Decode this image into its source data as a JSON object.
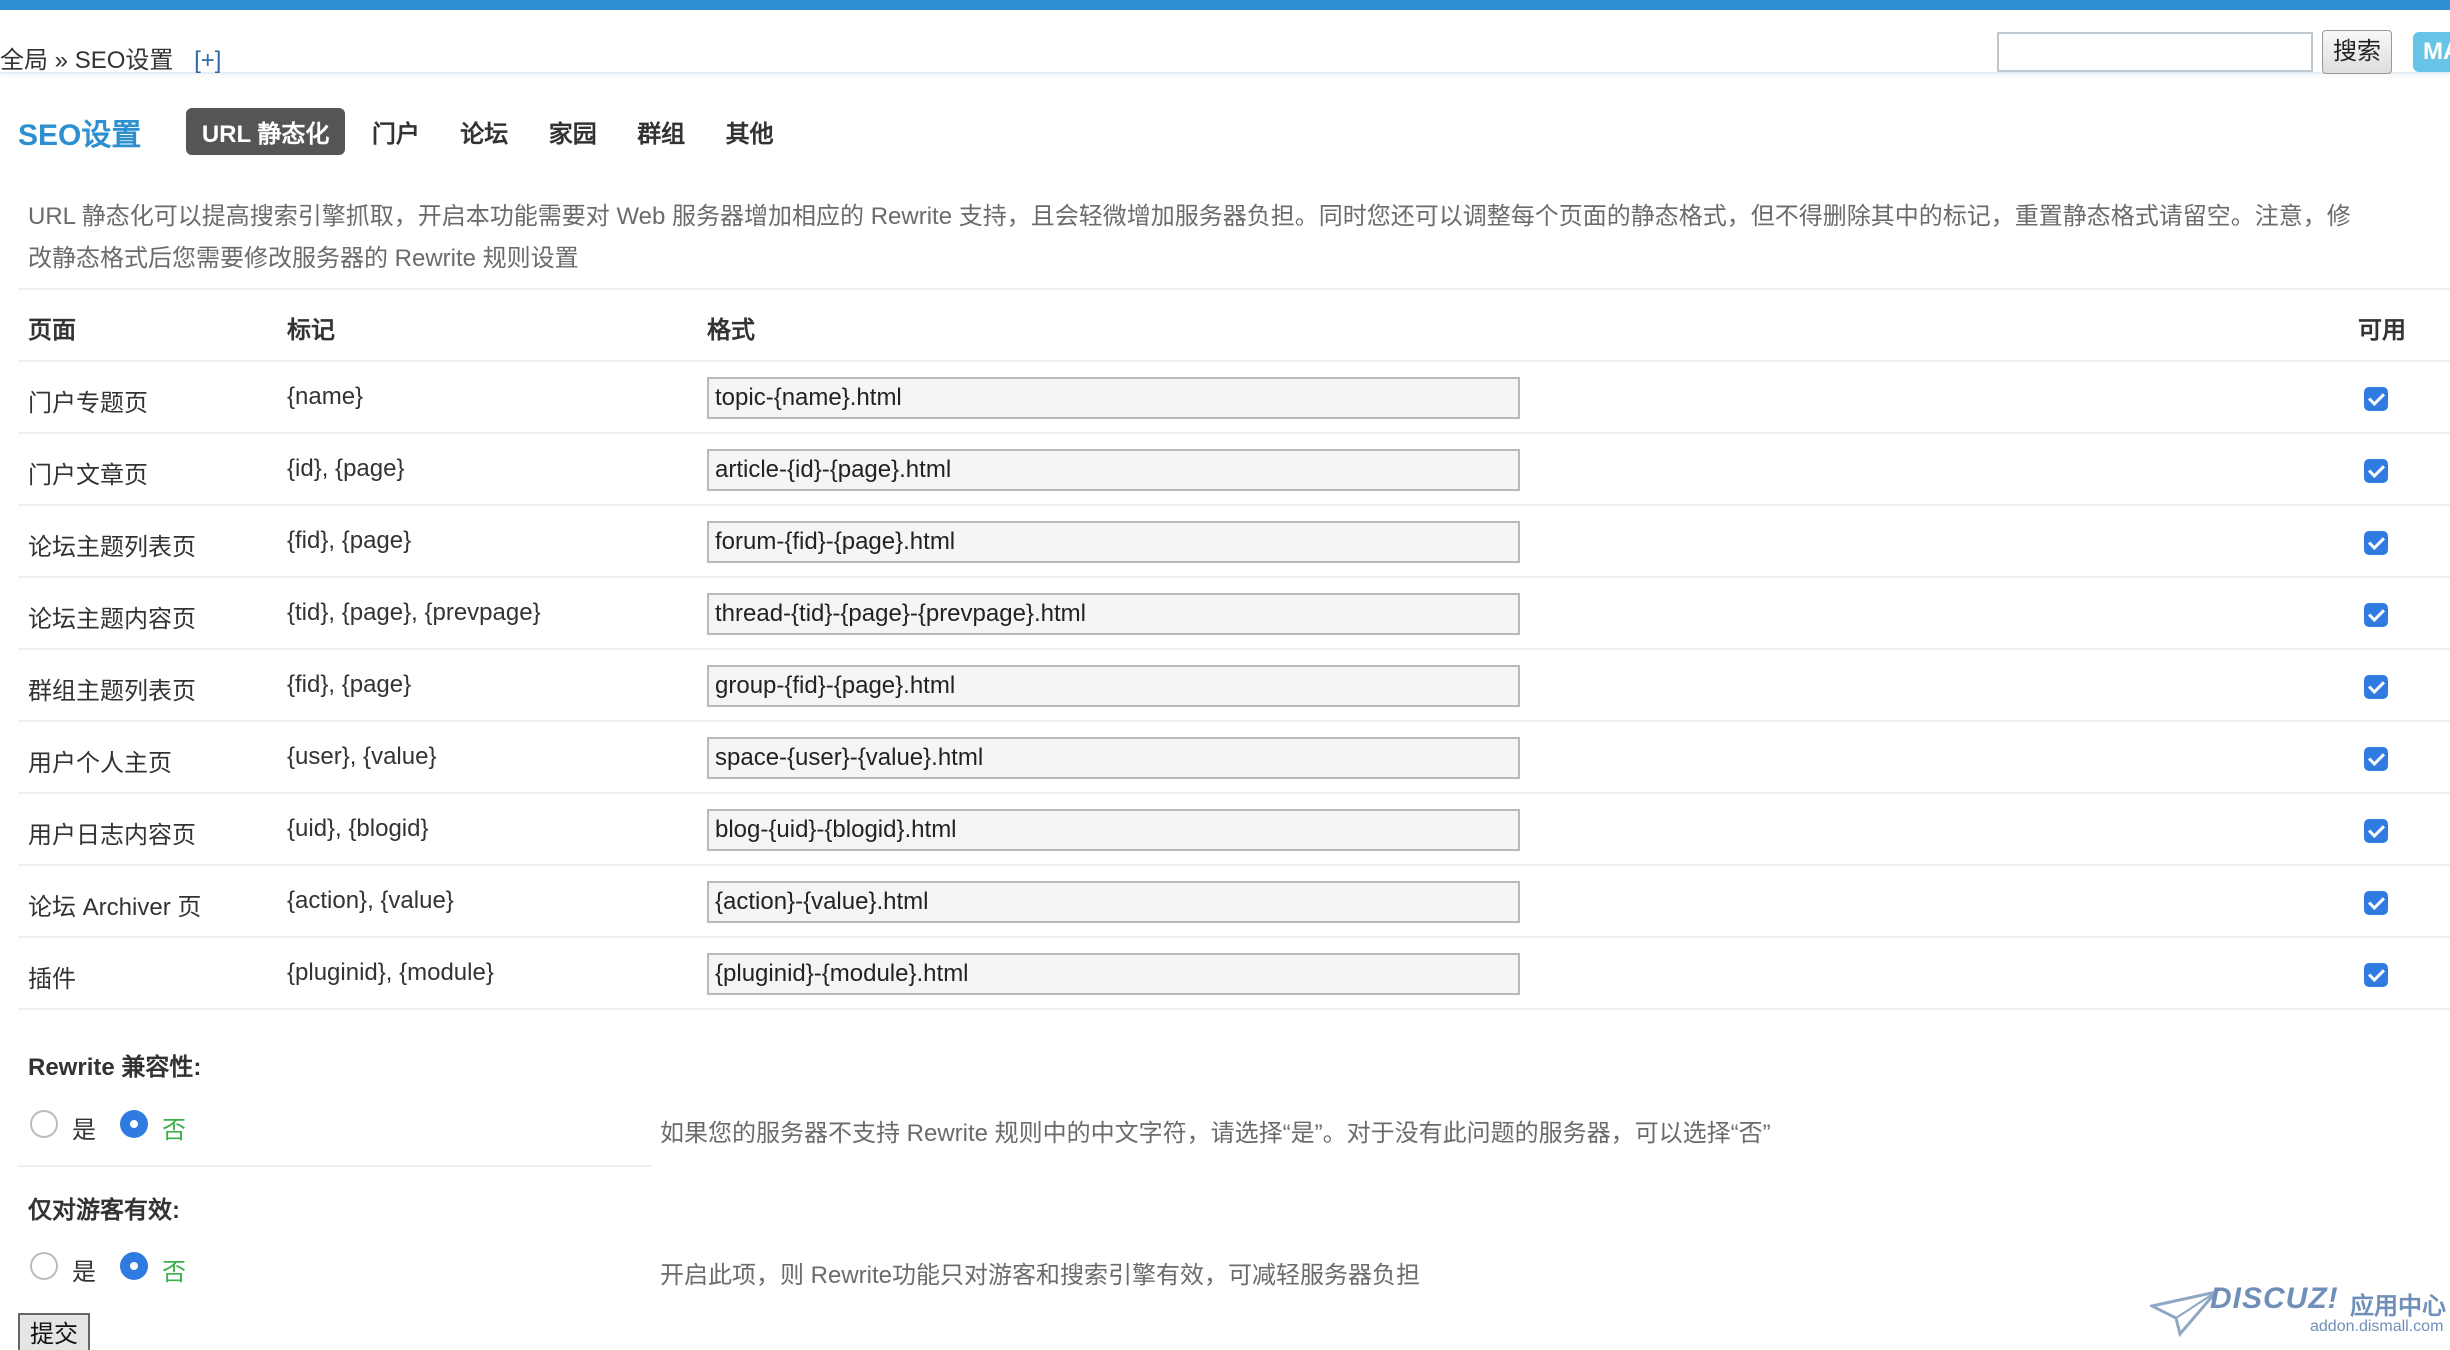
{
  "header": {
    "breadcrumb_root": "全局",
    "breadcrumb_sep": "»",
    "breadcrumb_current": "SEO设置",
    "breadcrumb_add": "[+]",
    "search_placeholder": "",
    "search_button": "搜索",
    "extra_button": "MA"
  },
  "tabs": {
    "title": "SEO设置",
    "items": [
      "URL 静态化",
      "门户",
      "论坛",
      "家园",
      "群组",
      "其他"
    ],
    "active_index": 0
  },
  "intro": "URL 静态化可以提高搜索引擎抓取，开启本功能需要对 Web 服务器增加相应的 Rewrite 支持，且会轻微增加服务器负担。同时您还可以调整每个页面的静态格式，但不得删除其中的标记，重置静态格式请留空。注意，修改静态格式后您需要修改服务器的 Rewrite 规则设置",
  "table": {
    "headers": {
      "page": "页面",
      "mark": "标记",
      "format": "格式",
      "enabled": "可用"
    },
    "rows": [
      {
        "page": "门户专题页",
        "mark": "{name}",
        "format": "topic-{name}.html",
        "enabled": true
      },
      {
        "page": "门户文章页",
        "mark": "{id}, {page}",
        "format": "article-{id}-{page}.html",
        "enabled": true
      },
      {
        "page": "论坛主题列表页",
        "mark": "{fid}, {page}",
        "format": "forum-{fid}-{page}.html",
        "enabled": true
      },
      {
        "page": "论坛主题内容页",
        "mark": "{tid}, {page}, {prevpage}",
        "format": "thread-{tid}-{page}-{prevpage}.html",
        "enabled": true
      },
      {
        "page": "群组主题列表页",
        "mark": "{fid}, {page}",
        "format": "group-{fid}-{page}.html",
        "enabled": true
      },
      {
        "page": "用户个人主页",
        "mark": "{user}, {value}",
        "format": "space-{user}-{value}.html",
        "enabled": true
      },
      {
        "page": "用户日志内容页",
        "mark": "{uid}, {blogid}",
        "format": "blog-{uid}-{blogid}.html",
        "enabled": true
      },
      {
        "page": "论坛 Archiver 页",
        "mark": "{action}, {value}",
        "format": "{action}-{value}.html",
        "enabled": true
      },
      {
        "page": "插件",
        "mark": "{pluginid}, {module}",
        "format": "{pluginid}-{module}.html",
        "enabled": true
      }
    ]
  },
  "options": [
    {
      "title": "Rewrite 兼容性:",
      "yes": "是",
      "no": "否",
      "selected": "否",
      "tip": "如果您的服务器不支持 Rewrite 规则中的中文字符，请选择“是”。对于没有此问题的服务器，可以选择“否”"
    },
    {
      "title": "仅对游客有效:",
      "yes": "是",
      "no": "否",
      "selected": "否",
      "tip": "开启此项，则 Rewrite功能只对游客和搜索引擎有效，可减轻服务器负担"
    }
  ],
  "submit_label": "提交",
  "watermark": {
    "brand": "DISCUZ!",
    "cn": "应用中心",
    "url": "addon.dismall.com"
  }
}
